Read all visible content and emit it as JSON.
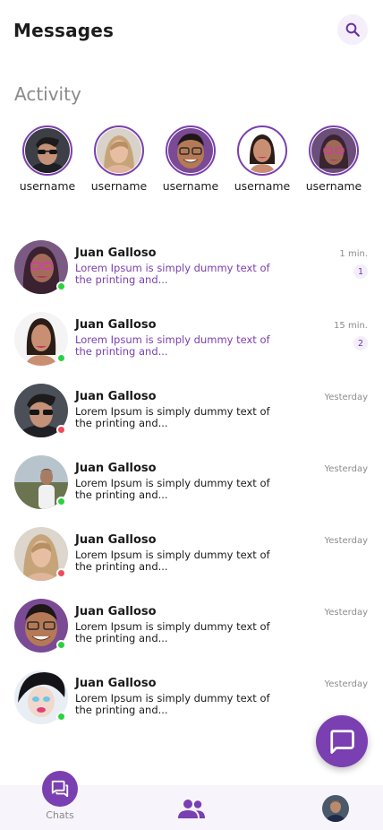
{
  "header": {
    "title": "Messages"
  },
  "activity": {
    "title": "Activity",
    "stories": [
      {
        "username": "username"
      },
      {
        "username": "username"
      },
      {
        "username": "username"
      },
      {
        "username": "username"
      },
      {
        "username": "username"
      }
    ]
  },
  "chats": [
    {
      "name": "Juan Galloso",
      "message": "Lorem Ipsum is simply dummy text of the printing and...",
      "time": "1 min.",
      "unread": "1",
      "status": "online"
    },
    {
      "name": "Juan Galloso",
      "message": "Lorem Ipsum is simply dummy text of the printing and...",
      "time": "15 min.",
      "unread": "2",
      "status": "online"
    },
    {
      "name": "Juan Galloso",
      "message": "Lorem Ipsum is simply dummy text of the printing and...",
      "time": "Yesterday",
      "status": "busy"
    },
    {
      "name": "Juan Galloso",
      "message": "Lorem Ipsum is simply dummy text of the printing and...",
      "time": "Yesterday",
      "status": "online"
    },
    {
      "name": "Juan Galloso",
      "message": "Lorem Ipsum is simply dummy text of the printing and...",
      "time": "Yesterday",
      "status": "busy"
    },
    {
      "name": "Juan Galloso",
      "message": "Lorem Ipsum is simply dummy text of the printing and...",
      "time": "Yesterday",
      "status": "online"
    },
    {
      "name": "Juan Galloso",
      "message": "Lorem Ipsum is simply dummy text of the printing and...",
      "time": "Yesterday",
      "status": "online"
    }
  ],
  "bottom_nav": {
    "chats_label": "Chats"
  },
  "colors": {
    "accent": "#7a3fb0",
    "online": "#2bd13f",
    "busy": "#ee4b5c"
  },
  "icons": {
    "search": "search-icon",
    "fab": "chat-bubble-icon",
    "chats": "forum-icon",
    "people": "people-icon"
  }
}
